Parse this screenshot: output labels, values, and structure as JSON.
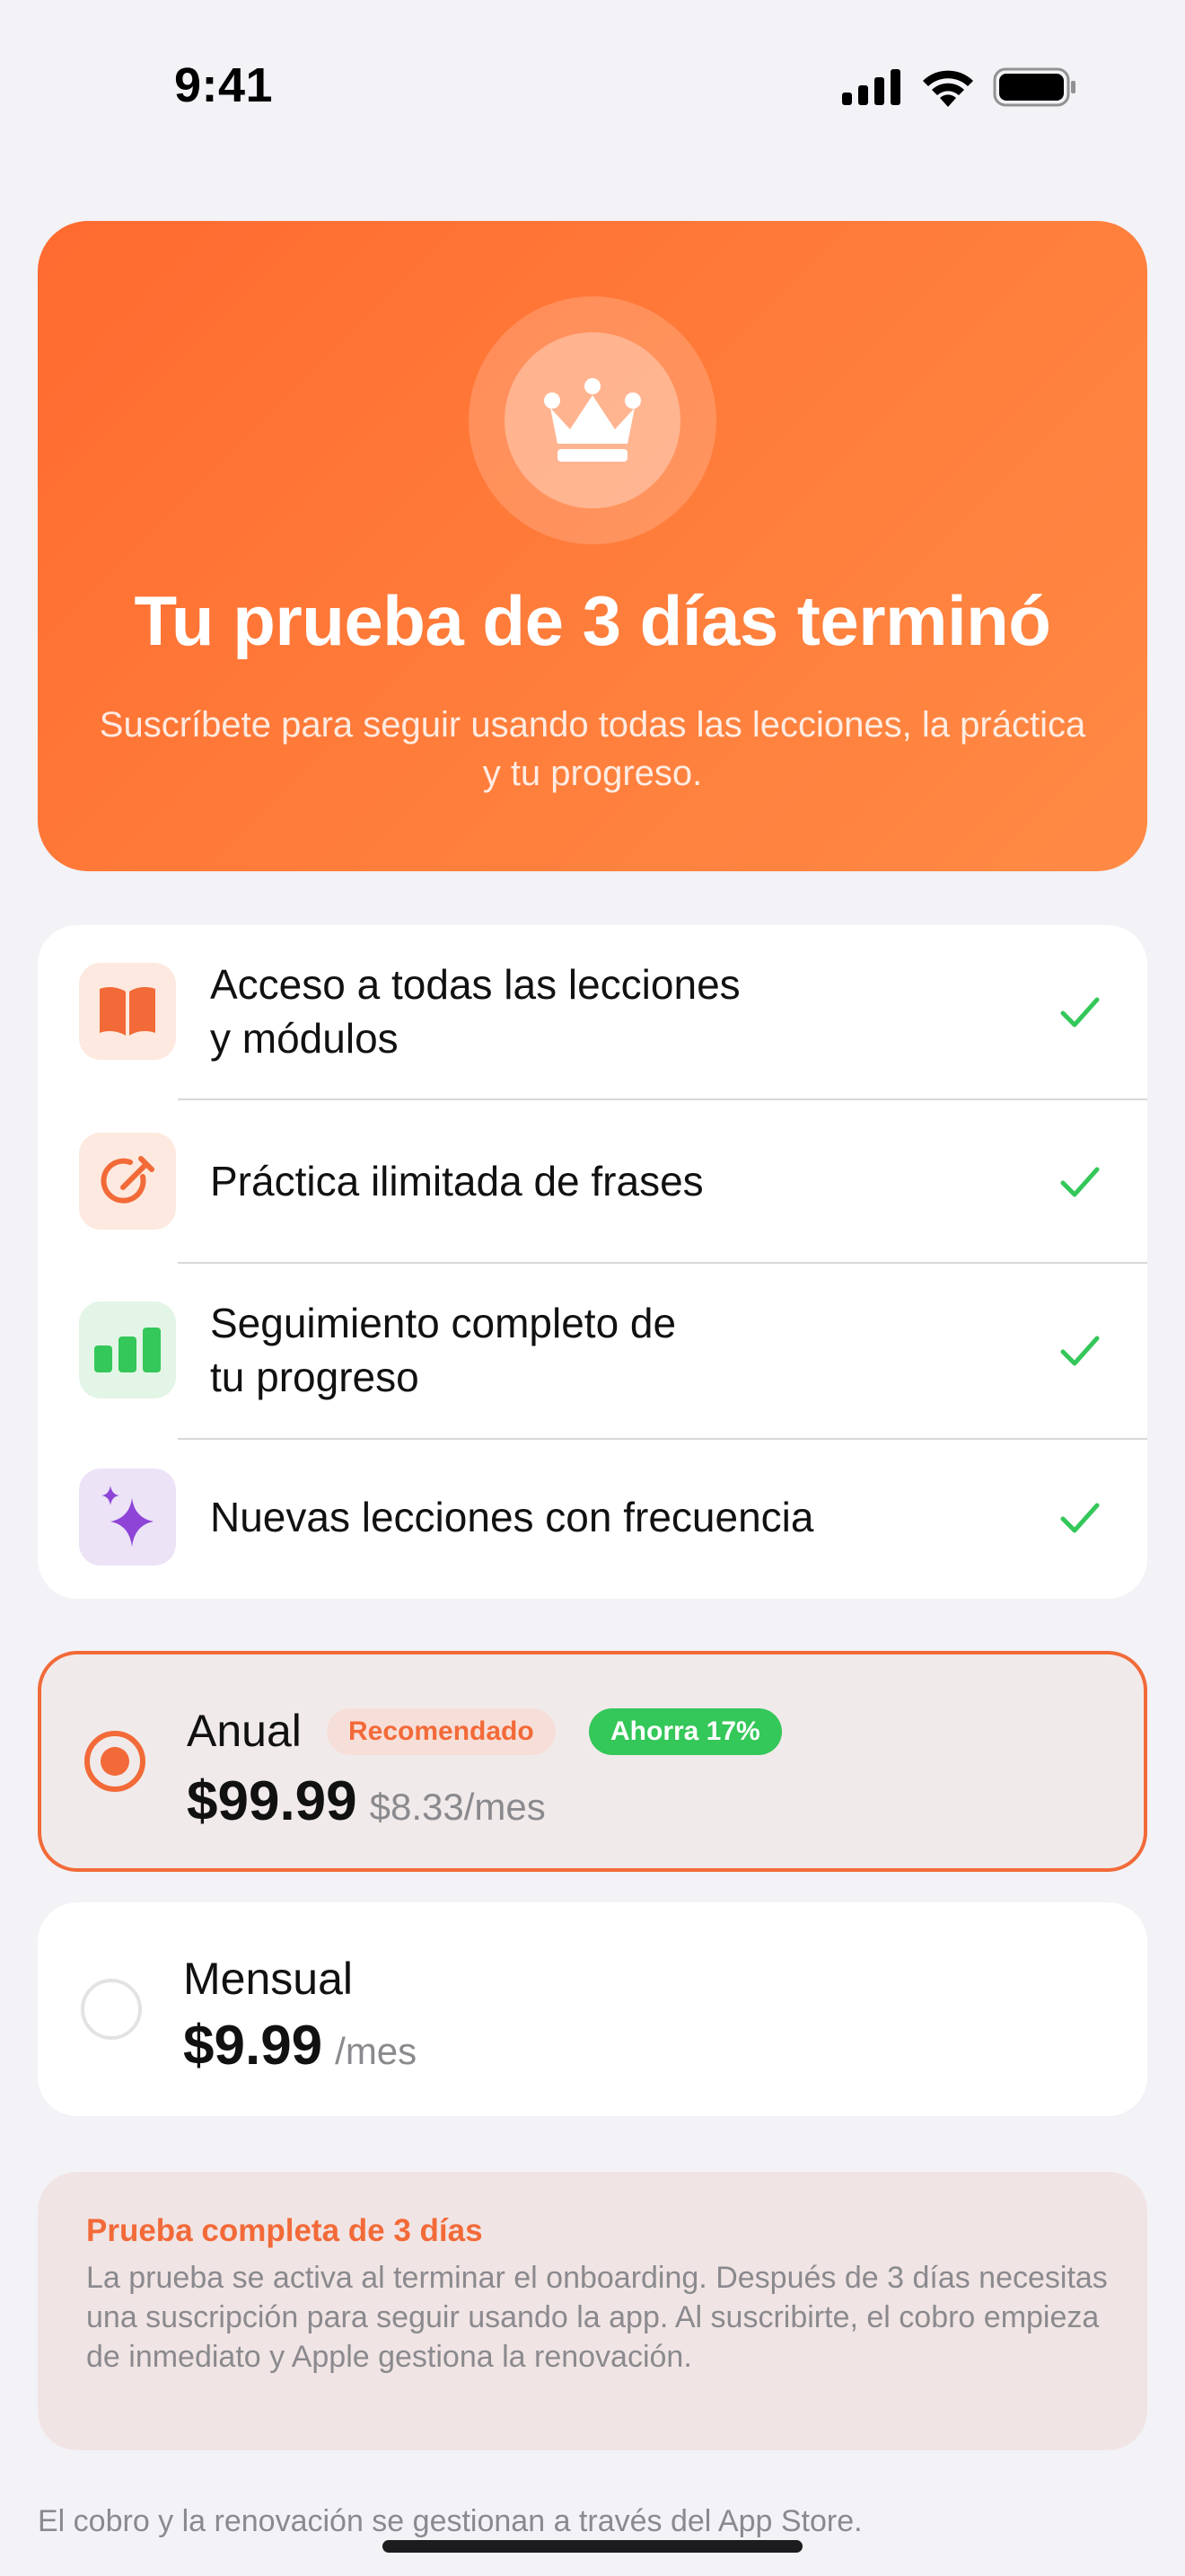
{
  "status_bar": {
    "time": "9:41"
  },
  "hero": {
    "title": "Tu prueba de 3 días terminó",
    "subtitle": "Suscríbete para seguir usando todas las lecciones, la práctica y tu progreso."
  },
  "features": [
    {
      "line1": "Acceso a todas las lecciones",
      "line2": "y módulos",
      "icon": "book-icon"
    },
    {
      "line1": "Práctica ilimitada de frases",
      "line2": "",
      "icon": "edit-target-icon"
    },
    {
      "line1": "Seguimiento completo de",
      "line2": "tu progreso",
      "icon": "bar-chart-icon"
    },
    {
      "line1": "Nuevas lecciones con frecuencia",
      "line2": "",
      "icon": "sparkles-icon"
    }
  ],
  "plans": {
    "annual": {
      "name": "Anual",
      "badge_recommended": "Recomendado",
      "badge_save": "Ahorra 17%",
      "price": "$99.99",
      "sub": "$8.33/mes",
      "selected": true
    },
    "monthly": {
      "name": "Mensual",
      "price": "$9.99",
      "sub": "/mes",
      "selected": false
    }
  },
  "info": {
    "title": "Prueba completa de 3 días",
    "body": "La prueba se activa al terminar el onboarding. Después de 3 días necesitas una suscripción para seguir usando la app. Al suscribirte, el cobro empieza de inmediato y Apple gestiona la renovación."
  },
  "footer": "El cobro y la renovación se gestionan a través del App Store.",
  "colors": {
    "accent": "#f26a38",
    "hero_gradient_start": "#ff6a2f",
    "hero_gradient_end": "#ff8a45",
    "check_green": "#34c759",
    "save_badge": "#34c759"
  }
}
